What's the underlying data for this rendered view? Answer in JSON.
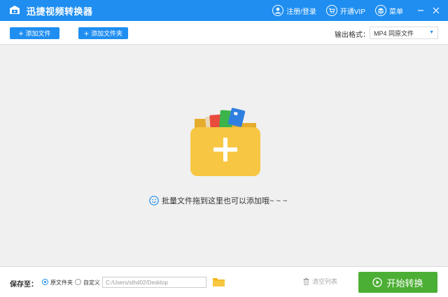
{
  "titlebar": {
    "title": "迅捷视频转换器",
    "login_label": "注册/登录",
    "vip_label": "开通VIP",
    "menu_label": "菜单"
  },
  "toolbar": {
    "add_file_label": "添加文件",
    "add_folder_label": "添加文件夹",
    "format_label": "输出格式：",
    "format_value": "MP4 同原文件"
  },
  "drop_area": {
    "hint": "批量文件拖到这里也可以添加哦~ ~ ~"
  },
  "bottom": {
    "save_label": "保存至：",
    "option_original": "原文件夹",
    "option_custom": "自定义",
    "path_value": "C:/Users/sthd02/Desktop",
    "clear_label": "清空列表",
    "start_label": "开始转换"
  },
  "colors": {
    "primary": "#1f8ef0",
    "start_green": "#4caf35",
    "folder_yellow": "#f7c744"
  }
}
